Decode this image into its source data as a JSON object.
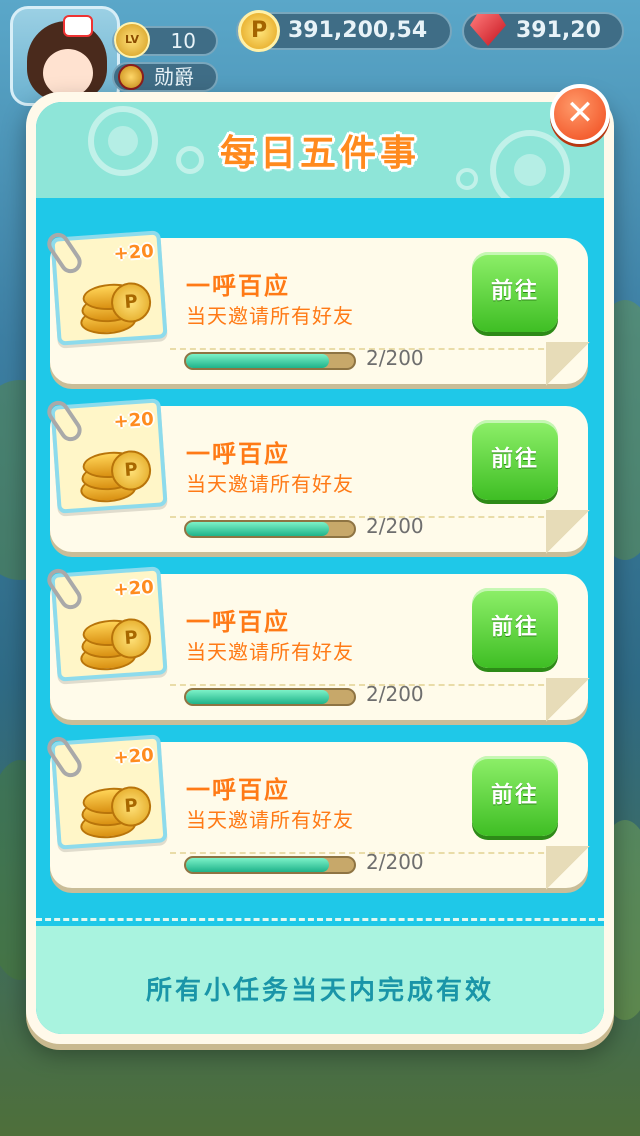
{
  "hud": {
    "level_badge": "LV",
    "level": "10",
    "medal_label": "勋爵",
    "coin_symbol": "P",
    "coins": "391,200,54",
    "gems": "391,20"
  },
  "dialog": {
    "title": "每日五件事",
    "close_label": "✕",
    "footer": "所有小任务当天内完成有效"
  },
  "tasks": [
    {
      "reward": "+20",
      "title": "一呼百应",
      "desc": "当天邀请所有好友",
      "button": "前往",
      "progress_text": "2/200",
      "progress_fraction": 0.85
    },
    {
      "reward": "+20",
      "title": "一呼百应",
      "desc": "当天邀请所有好友",
      "button": "前往",
      "progress_text": "2/200",
      "progress_fraction": 0.85
    },
    {
      "reward": "+20",
      "title": "一呼百应",
      "desc": "当天邀请所有好友",
      "button": "前往",
      "progress_text": "2/200",
      "progress_fraction": 0.85
    },
    {
      "reward": "+20",
      "title": "一呼百应",
      "desc": "当天邀请所有好友",
      "button": "前往",
      "progress_text": "2/200",
      "progress_fraction": 0.85
    }
  ],
  "colors": {
    "accent_orange": "#ff7a16",
    "button_green": "#3fbe24",
    "panel_cyan": "#1fc8e8",
    "close_red": "#f0491c"
  }
}
